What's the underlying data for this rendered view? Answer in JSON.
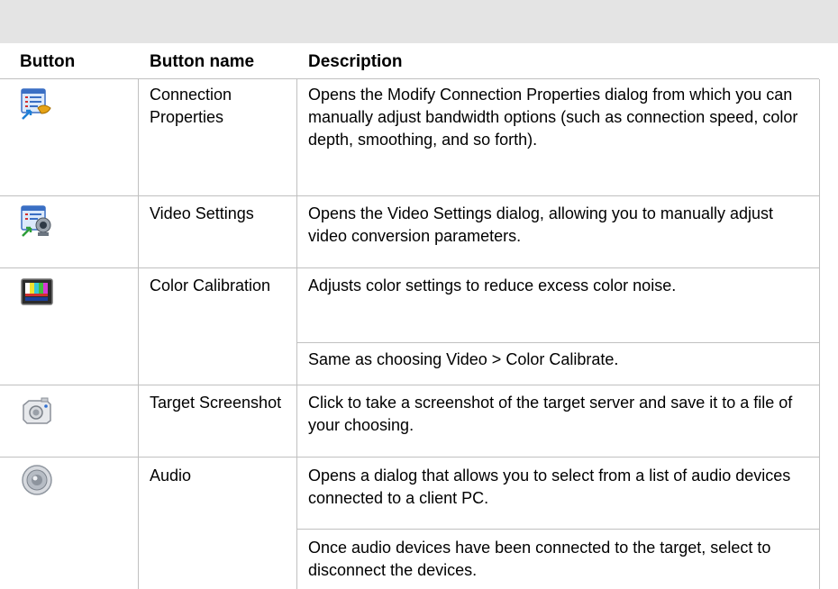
{
  "header": {
    "button": "Button",
    "button_name": "Button name",
    "description": "Description"
  },
  "rows": [
    {
      "icon": "connection-properties-icon",
      "name": "Connection Properties",
      "description": [
        "Opens the Modify Connection Properties dialog from which you can manually adjust bandwidth options (such as connection speed, color depth, smoothing, and so forth)."
      ]
    },
    {
      "icon": "video-settings-icon",
      "name": "Video Settings",
      "description": [
        "Opens the Video Settings dialog, allowing you to manually adjust video conversion parameters."
      ]
    },
    {
      "icon": "color-calibration-icon",
      "name": "Color Calibration",
      "description": [
        "Adjusts color settings to reduce excess color noise.",
        "Same as choosing Video > Color Calibrate."
      ]
    },
    {
      "icon": "camera-icon",
      "name": "Target Screenshot",
      "description": [
        "Click to take a screenshot of the target server and save it to a file of your choosing."
      ]
    },
    {
      "icon": "speaker-icon",
      "name": "Audio",
      "description": [
        "Opens a dialog that allows you to select from a list of audio devices connected to a client PC.",
        "Once audio devices have been connected to the target, select to disconnect the devices."
      ]
    }
  ]
}
